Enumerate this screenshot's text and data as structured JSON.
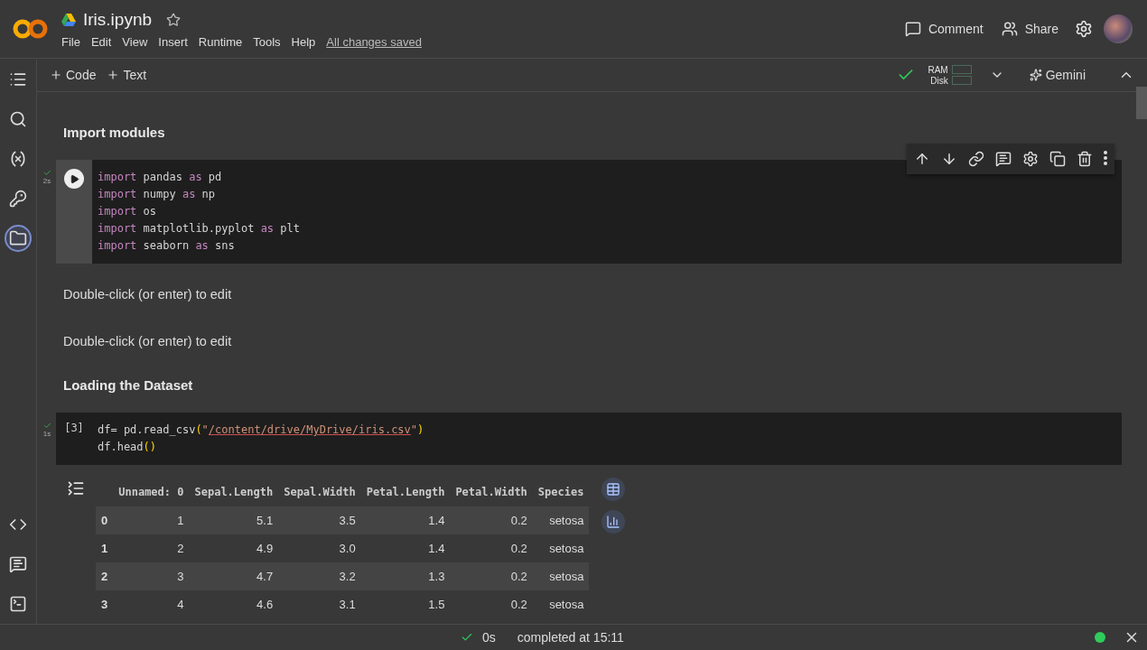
{
  "header": {
    "title": "Iris.ipynb",
    "starred": false,
    "menu": [
      "File",
      "Edit",
      "View",
      "Insert",
      "Runtime",
      "Tools",
      "Help"
    ],
    "save_status": "All changes saved",
    "actions": [
      {
        "kind": "comment",
        "label": "Comment"
      },
      {
        "kind": "share",
        "label": "Share"
      }
    ]
  },
  "toolbar": {
    "add": [
      "Code",
      "Text"
    ],
    "ram_label": "RAM",
    "disk_label": "Disk",
    "gemini": "Gemini"
  },
  "rail": [
    {
      "kind": "toc",
      "selected": false
    },
    {
      "kind": "search",
      "selected": false
    },
    {
      "kind": "variables",
      "selected": false
    },
    {
      "kind": "secrets",
      "selected": false
    },
    {
      "kind": "files",
      "selected": true
    }
  ],
  "rail_bottom": [
    {
      "kind": "snippets"
    },
    {
      "kind": "palette"
    },
    {
      "kind": "terminal"
    }
  ],
  "cells": [
    {
      "kind": "heading",
      "text": "Import modules"
    },
    {
      "kind": "code",
      "run_time": "2s",
      "toolbar": true,
      "lines": [
        [
          {
            "t": "import",
            "kind": "keyword"
          },
          {
            "t": " pandas ",
            "kind": "plain"
          },
          {
            "t": "as",
            "kind": "keyword"
          },
          {
            "t": " pd",
            "kind": "plain"
          }
        ],
        [
          {
            "t": "import",
            "kind": "keyword"
          },
          {
            "t": " numpy ",
            "kind": "plain"
          },
          {
            "t": "as",
            "kind": "keyword"
          },
          {
            "t": " np",
            "kind": "plain"
          }
        ],
        [
          {
            "t": "import",
            "kind": "keyword"
          },
          {
            "t": " os",
            "kind": "plain"
          }
        ],
        [
          {
            "t": "import",
            "kind": "keyword"
          },
          {
            "t": " matplotlib.pyplot ",
            "kind": "plain"
          },
          {
            "t": "as",
            "kind": "keyword"
          },
          {
            "t": " plt",
            "kind": "plain"
          }
        ],
        [
          {
            "t": "import",
            "kind": "keyword"
          },
          {
            "t": " seaborn ",
            "kind": "plain"
          },
          {
            "t": "as",
            "kind": "keyword"
          },
          {
            "t": " sns",
            "kind": "plain"
          }
        ]
      ]
    },
    {
      "kind": "text",
      "text": "Double-click (or enter) to edit"
    },
    {
      "kind": "text",
      "text": "Double-click (or enter) to edit"
    },
    {
      "kind": "heading",
      "text": "Loading the Dataset"
    },
    {
      "kind": "code",
      "run_time": "1s",
      "prompt": "[3]",
      "toolbar": false,
      "lines": [
        [
          {
            "t": "df= pd.read_csv",
            "kind": "plain"
          },
          {
            "t": "(",
            "kind": "paren"
          },
          {
            "t": "\"",
            "kind": "quote"
          },
          {
            "t": "/content/drive/MyDrive/iris.csv",
            "kind": "path"
          },
          {
            "t": "\"",
            "kind": "quote"
          },
          {
            "t": ")",
            "kind": "paren"
          }
        ],
        [
          {
            "t": "df.head",
            "kind": "plain"
          },
          {
            "t": "()",
            "kind": "paren"
          }
        ]
      ]
    },
    {
      "kind": "table",
      "columns": [
        "",
        "Unnamed: 0",
        "Sepal.Length",
        "Sepal.Width",
        "Petal.Length",
        "Petal.Width",
        "Species"
      ],
      "rows": [
        [
          "0",
          "1",
          "5.1",
          "3.5",
          "1.4",
          "0.2",
          "setosa"
        ],
        [
          "1",
          "2",
          "4.9",
          "3.0",
          "1.4",
          "0.2",
          "setosa"
        ],
        [
          "2",
          "3",
          "4.7",
          "3.2",
          "1.3",
          "0.2",
          "setosa"
        ],
        [
          "3",
          "4",
          "4.6",
          "3.1",
          "1.5",
          "0.2",
          "setosa"
        ]
      ]
    }
  ],
  "status": {
    "duration": "0s",
    "completed": "completed at 15:11",
    "connected": true
  }
}
